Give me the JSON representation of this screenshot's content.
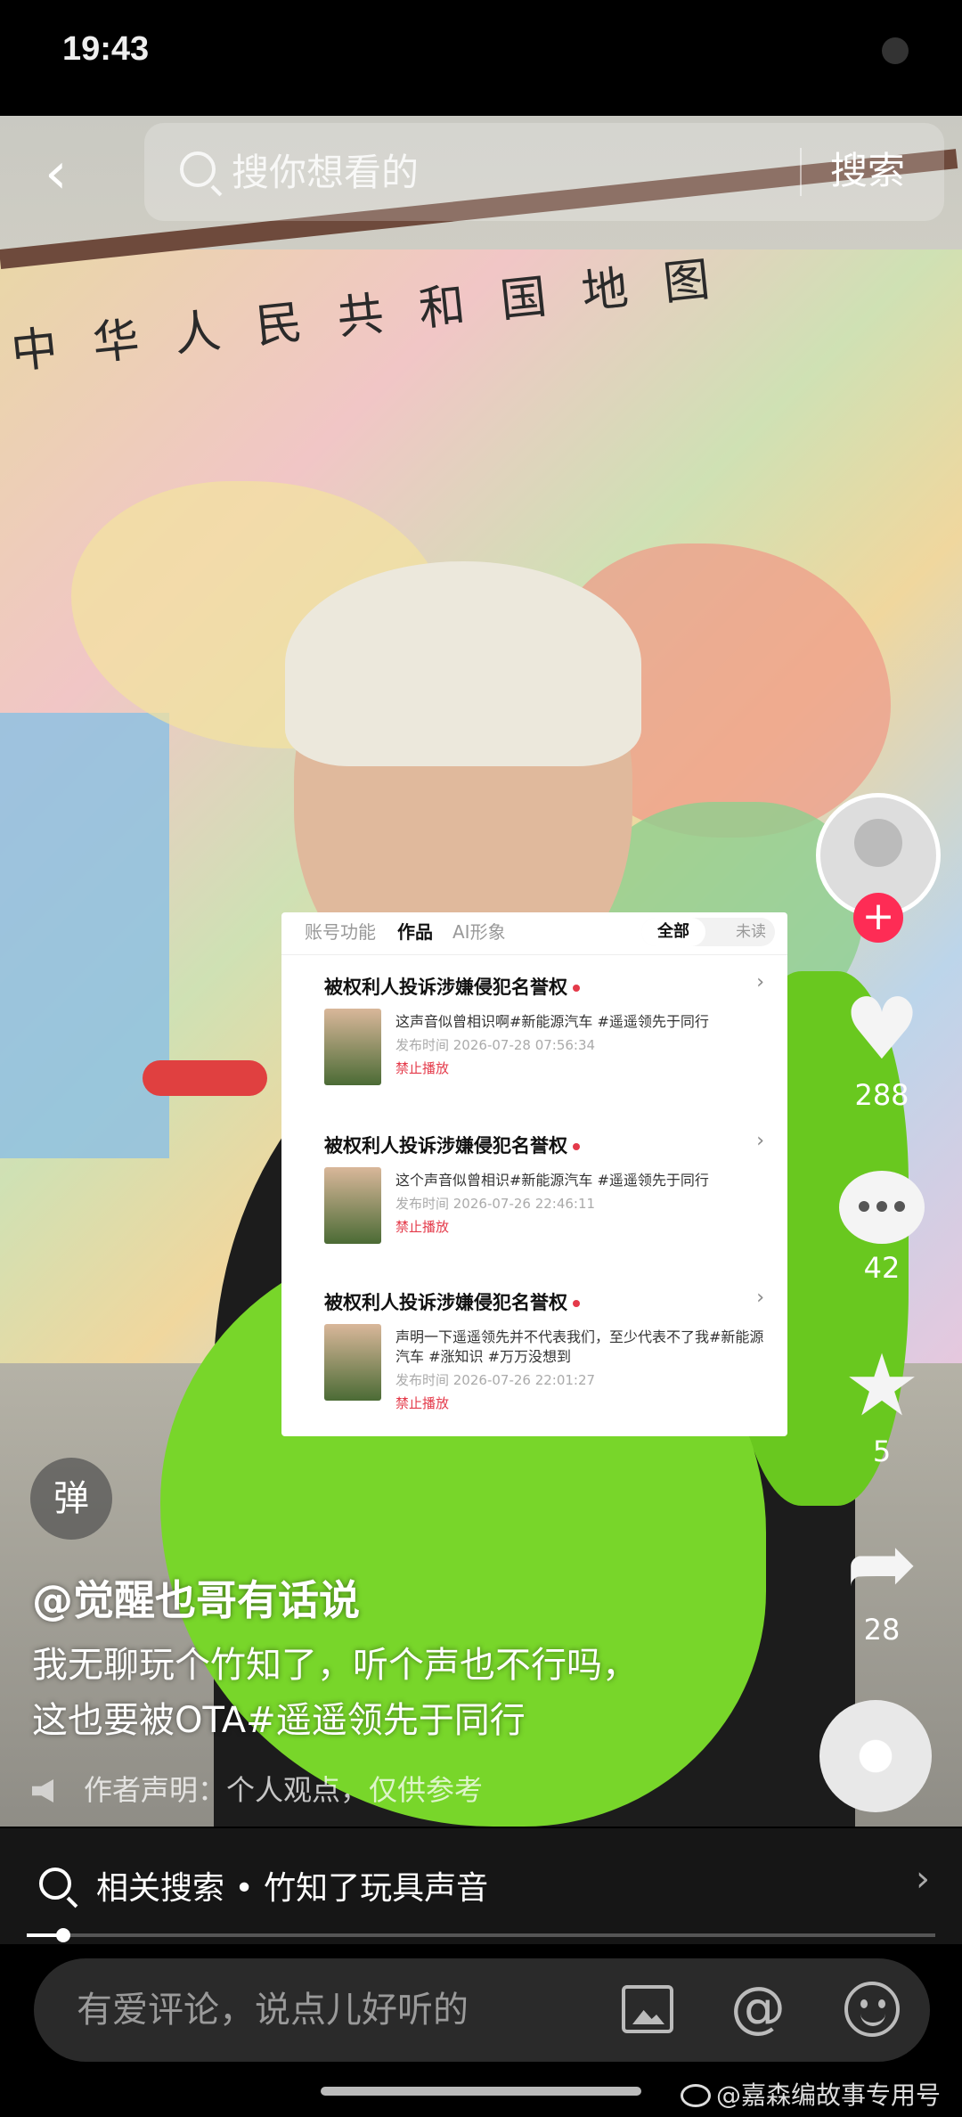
{
  "status_bar": {
    "time": "19:43"
  },
  "search": {
    "placeholder": "搜你想看的",
    "button": "搜索"
  },
  "video": {
    "map_title": "中华人民共和国地图"
  },
  "overlay_panel": {
    "tabs": [
      "账号功能",
      "作品",
      "AI形象"
    ],
    "active_tab": "作品",
    "toggle": {
      "all": "全部",
      "unread": "未读"
    },
    "items": [
      {
        "title": "被权利人投诉涉嫌侵犯名誉权",
        "desc": "这声音似曾相识啊#新能源汽车 #遥遥领先于同行",
        "time": "发布时间 2026-07-28 07:56:34",
        "status": "禁止播放"
      },
      {
        "title": "被权利人投诉涉嫌侵犯名誉权",
        "desc": "这个声音似曾相识#新能源汽车 #遥遥领先于同行",
        "time": "发布时间 2026-07-26 22:46:11",
        "status": "禁止播放"
      },
      {
        "title": "被权利人投诉涉嫌侵犯名誉权",
        "desc": "声明一下遥遥领先并不代表我们，至少代表不了我#新能源汽车 #涨知识 #万万没想到",
        "time": "发布时间 2026-07-26 22:01:27",
        "status": "禁止播放"
      }
    ]
  },
  "danmu_label": "弹",
  "author": "@觉醒也哥有话说",
  "caption_lines": [
    "我无聊玩个竹知了，听个声也不行吗，",
    "这也要被OTA#遥遥领先于同行"
  ],
  "disclaimer": "作者声明：个人观点，仅供参考",
  "actions": {
    "likes": "288",
    "comments": "42",
    "favorites": "5",
    "shares": "28"
  },
  "related_search": "相关搜索 • 竹知了玩具声音",
  "playback_progress": 0.04,
  "comment_placeholder": "有爱评论，说点儿好听的",
  "watermark": "@嘉森编故事专用号"
}
